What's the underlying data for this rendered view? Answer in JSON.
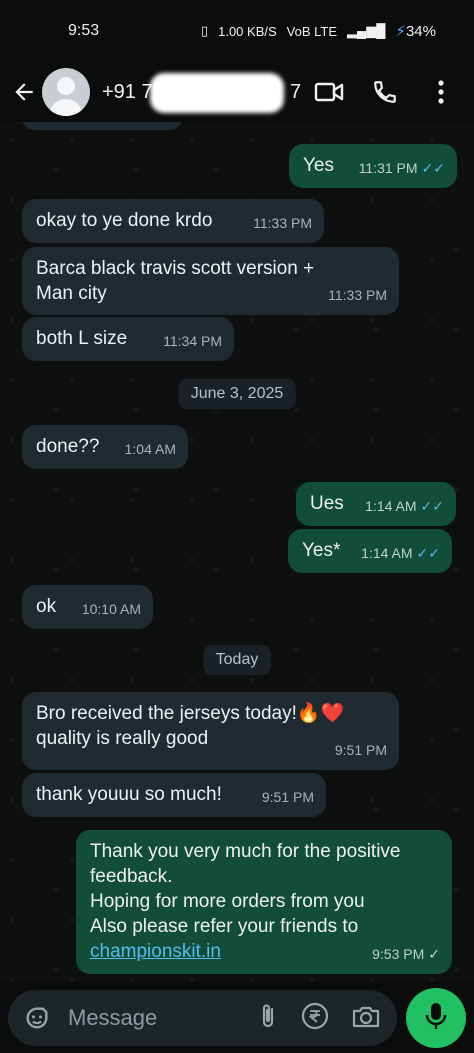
{
  "status_bar": {
    "time": "9:53",
    "speed": "1.00 KB/S",
    "network": "VoB LTE",
    "signal": "4G",
    "battery": "34%"
  },
  "header": {
    "contact_name": "+91 74",
    "contact_suffix": "7"
  },
  "messages": [
    {
      "text": "Yes",
      "time": "11:31 PM",
      "dir": "out",
      "status": "read"
    },
    {
      "text": "okay to ye done krdo",
      "time": "11:33 PM",
      "dir": "in"
    },
    {
      "text": "Barca black travis scott version + Man city",
      "time": "11:33 PM",
      "dir": "in"
    },
    {
      "text": "both L size",
      "time": "11:34 PM",
      "dir": "in"
    },
    {
      "text": "done??",
      "time": "1:04 AM",
      "dir": "in"
    },
    {
      "text": "Ues",
      "time": "1:14 AM",
      "dir": "out",
      "status": "read"
    },
    {
      "text": "Yes*",
      "time": "1:14 AM",
      "dir": "out",
      "status": "read"
    },
    {
      "text": "ok",
      "time": "10:10 AM",
      "dir": "in"
    },
    {
      "text": "Bro received the jerseys today!🔥❤️ quality is really good",
      "time": "9:51 PM",
      "dir": "in"
    },
    {
      "text": "thank youuu so much!",
      "time": "9:51 PM",
      "dir": "in"
    },
    {
      "text": "Thank you very much for the positive feedback.",
      "time": "9:53 PM",
      "dir": "out",
      "status": "sent"
    }
  ],
  "last_message_extra": {
    "line1": "Hoping for more orders from you",
    "line2": "Also please refer your friends to",
    "link": "championskit.in"
  },
  "date_separators": [
    "June 3, 2025",
    "Today"
  ],
  "composer": {
    "placeholder": "Message"
  },
  "icons": [
    "back-arrow-icon",
    "avatar",
    "video-call-icon",
    "phone-icon",
    "more-icon",
    "sticker-icon",
    "attach-icon",
    "rupee-icon",
    "camera-icon",
    "mic-icon"
  ],
  "colors": {
    "incoming_bubble": "#1f2a31",
    "outgoing_bubble": "#114d38",
    "read_ticks": "#53bdeb",
    "mic_button": "#21c063"
  }
}
